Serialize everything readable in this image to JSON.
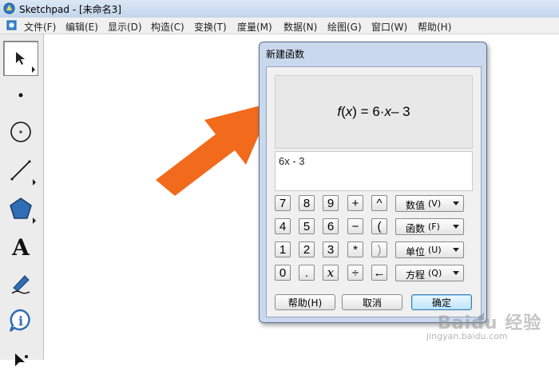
{
  "window": {
    "title": "Sketchpad  - [未命名3]"
  },
  "menu": [
    {
      "label": "文件(F)"
    },
    {
      "label": "编辑(E)"
    },
    {
      "label": "显示(D)"
    },
    {
      "label": "构造(C)"
    },
    {
      "label": "变换(T)"
    },
    {
      "label": "度量(M)"
    },
    {
      "label": "数据(N)"
    },
    {
      "label": "绘图(G)"
    },
    {
      "label": "窗口(W)"
    },
    {
      "label": "帮助(H)"
    }
  ],
  "toolbox": [
    {
      "icon": "arrow-select-icon",
      "selected": true
    },
    {
      "icon": "point-icon"
    },
    {
      "icon": "compass-icon"
    },
    {
      "icon": "line-segment-icon"
    },
    {
      "icon": "polygon-icon"
    },
    {
      "icon": "text-icon",
      "text": "A"
    },
    {
      "icon": "marker-icon"
    },
    {
      "icon": "information-icon",
      "text": "i"
    },
    {
      "icon": "custom-tool-icon"
    }
  ],
  "dialog": {
    "title": "新建函数",
    "preview": {
      "fname": "f",
      "var": "x",
      "rhs_num": "6·",
      "rhs_tail": " – 3"
    },
    "expression": "6x - 3",
    "keypad": [
      [
        "7",
        "8",
        "9",
        "+",
        "^"
      ],
      [
        "4",
        "5",
        "6",
        "−",
        "("
      ],
      [
        "1",
        "2",
        "3",
        "*",
        ")"
      ],
      [
        "0",
        ".",
        "x",
        "÷",
        "←"
      ]
    ],
    "dropdowns": [
      {
        "label": "数值",
        "hotkey": "(V)"
      },
      {
        "label": "函数",
        "hotkey": "(F)"
      },
      {
        "label": "单位",
        "hotkey": "(U)"
      },
      {
        "label": "方程",
        "hotkey": "(Q)"
      }
    ],
    "buttons": {
      "help": "帮助(H)",
      "cancel": "取消",
      "ok": "确定"
    }
  },
  "watermark": {
    "brand": "Baidu 经验",
    "url": "jingyan.baidu.com"
  },
  "colors": {
    "arrow": "#f26a1b",
    "dialog_frame": "#c9d8ec"
  }
}
